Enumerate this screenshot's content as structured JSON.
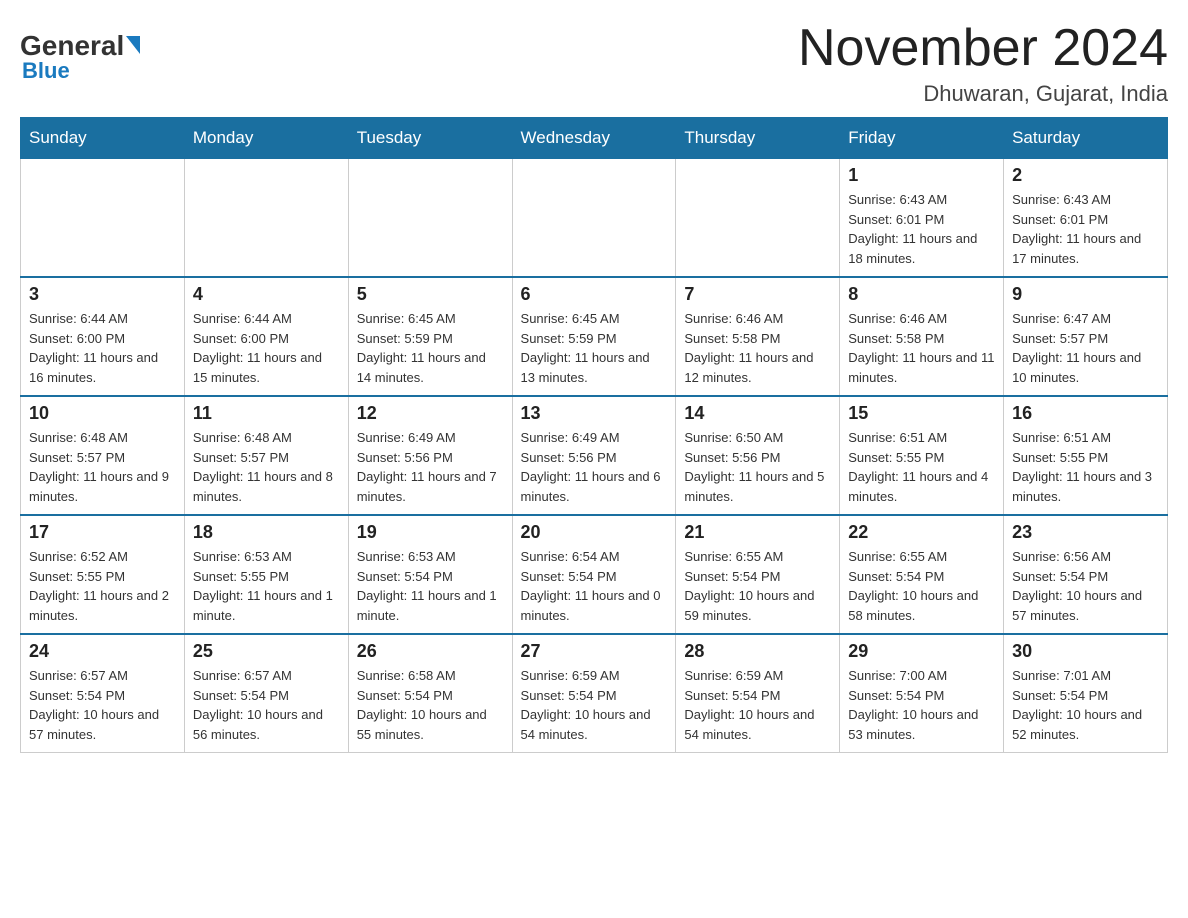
{
  "header": {
    "logo": {
      "general": "General",
      "blue": "Blue"
    },
    "title": "November 2024",
    "location": "Dhuwaran, Gujarat, India"
  },
  "days_of_week": [
    "Sunday",
    "Monday",
    "Tuesday",
    "Wednesday",
    "Thursday",
    "Friday",
    "Saturday"
  ],
  "weeks": [
    [
      {
        "day": "",
        "info": ""
      },
      {
        "day": "",
        "info": ""
      },
      {
        "day": "",
        "info": ""
      },
      {
        "day": "",
        "info": ""
      },
      {
        "day": "",
        "info": ""
      },
      {
        "day": "1",
        "info": "Sunrise: 6:43 AM\nSunset: 6:01 PM\nDaylight: 11 hours and 18 minutes."
      },
      {
        "day": "2",
        "info": "Sunrise: 6:43 AM\nSunset: 6:01 PM\nDaylight: 11 hours and 17 minutes."
      }
    ],
    [
      {
        "day": "3",
        "info": "Sunrise: 6:44 AM\nSunset: 6:00 PM\nDaylight: 11 hours and 16 minutes."
      },
      {
        "day": "4",
        "info": "Sunrise: 6:44 AM\nSunset: 6:00 PM\nDaylight: 11 hours and 15 minutes."
      },
      {
        "day": "5",
        "info": "Sunrise: 6:45 AM\nSunset: 5:59 PM\nDaylight: 11 hours and 14 minutes."
      },
      {
        "day": "6",
        "info": "Sunrise: 6:45 AM\nSunset: 5:59 PM\nDaylight: 11 hours and 13 minutes."
      },
      {
        "day": "7",
        "info": "Sunrise: 6:46 AM\nSunset: 5:58 PM\nDaylight: 11 hours and 12 minutes."
      },
      {
        "day": "8",
        "info": "Sunrise: 6:46 AM\nSunset: 5:58 PM\nDaylight: 11 hours and 11 minutes."
      },
      {
        "day": "9",
        "info": "Sunrise: 6:47 AM\nSunset: 5:57 PM\nDaylight: 11 hours and 10 minutes."
      }
    ],
    [
      {
        "day": "10",
        "info": "Sunrise: 6:48 AM\nSunset: 5:57 PM\nDaylight: 11 hours and 9 minutes."
      },
      {
        "day": "11",
        "info": "Sunrise: 6:48 AM\nSunset: 5:57 PM\nDaylight: 11 hours and 8 minutes."
      },
      {
        "day": "12",
        "info": "Sunrise: 6:49 AM\nSunset: 5:56 PM\nDaylight: 11 hours and 7 minutes."
      },
      {
        "day": "13",
        "info": "Sunrise: 6:49 AM\nSunset: 5:56 PM\nDaylight: 11 hours and 6 minutes."
      },
      {
        "day": "14",
        "info": "Sunrise: 6:50 AM\nSunset: 5:56 PM\nDaylight: 11 hours and 5 minutes."
      },
      {
        "day": "15",
        "info": "Sunrise: 6:51 AM\nSunset: 5:55 PM\nDaylight: 11 hours and 4 minutes."
      },
      {
        "day": "16",
        "info": "Sunrise: 6:51 AM\nSunset: 5:55 PM\nDaylight: 11 hours and 3 minutes."
      }
    ],
    [
      {
        "day": "17",
        "info": "Sunrise: 6:52 AM\nSunset: 5:55 PM\nDaylight: 11 hours and 2 minutes."
      },
      {
        "day": "18",
        "info": "Sunrise: 6:53 AM\nSunset: 5:55 PM\nDaylight: 11 hours and 1 minute."
      },
      {
        "day": "19",
        "info": "Sunrise: 6:53 AM\nSunset: 5:54 PM\nDaylight: 11 hours and 1 minute."
      },
      {
        "day": "20",
        "info": "Sunrise: 6:54 AM\nSunset: 5:54 PM\nDaylight: 11 hours and 0 minutes."
      },
      {
        "day": "21",
        "info": "Sunrise: 6:55 AM\nSunset: 5:54 PM\nDaylight: 10 hours and 59 minutes."
      },
      {
        "day": "22",
        "info": "Sunrise: 6:55 AM\nSunset: 5:54 PM\nDaylight: 10 hours and 58 minutes."
      },
      {
        "day": "23",
        "info": "Sunrise: 6:56 AM\nSunset: 5:54 PM\nDaylight: 10 hours and 57 minutes."
      }
    ],
    [
      {
        "day": "24",
        "info": "Sunrise: 6:57 AM\nSunset: 5:54 PM\nDaylight: 10 hours and 57 minutes."
      },
      {
        "day": "25",
        "info": "Sunrise: 6:57 AM\nSunset: 5:54 PM\nDaylight: 10 hours and 56 minutes."
      },
      {
        "day": "26",
        "info": "Sunrise: 6:58 AM\nSunset: 5:54 PM\nDaylight: 10 hours and 55 minutes."
      },
      {
        "day": "27",
        "info": "Sunrise: 6:59 AM\nSunset: 5:54 PM\nDaylight: 10 hours and 54 minutes."
      },
      {
        "day": "28",
        "info": "Sunrise: 6:59 AM\nSunset: 5:54 PM\nDaylight: 10 hours and 54 minutes."
      },
      {
        "day": "29",
        "info": "Sunrise: 7:00 AM\nSunset: 5:54 PM\nDaylight: 10 hours and 53 minutes."
      },
      {
        "day": "30",
        "info": "Sunrise: 7:01 AM\nSunset: 5:54 PM\nDaylight: 10 hours and 52 minutes."
      }
    ]
  ]
}
